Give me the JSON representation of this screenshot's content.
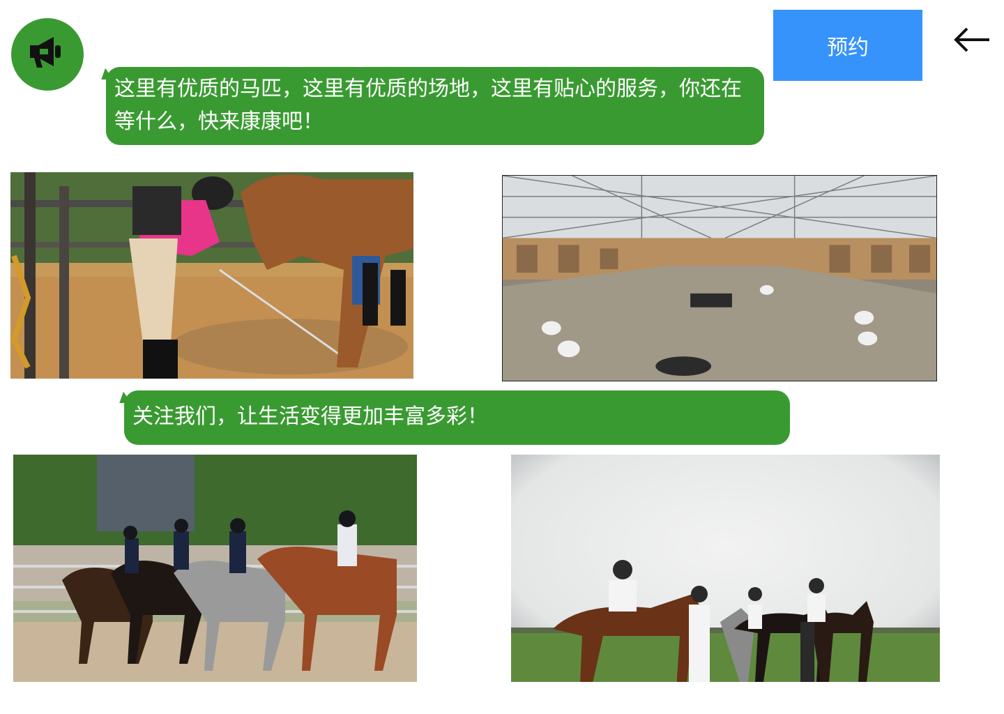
{
  "header": {
    "book_label": "预约",
    "back_icon": "arrow-left-icon",
    "avatar_icon": "megaphone-icon"
  },
  "messages": [
    {
      "text": "这里有优质的马匹，这里有优质的场地，这里有贴心的服务，你还在等什么，快来康康吧！"
    },
    {
      "text": "关注我们，让生活变得更加丰富多彩！"
    }
  ],
  "colors": {
    "accent_green": "#3a9a32",
    "button_blue": "#3693fb"
  }
}
